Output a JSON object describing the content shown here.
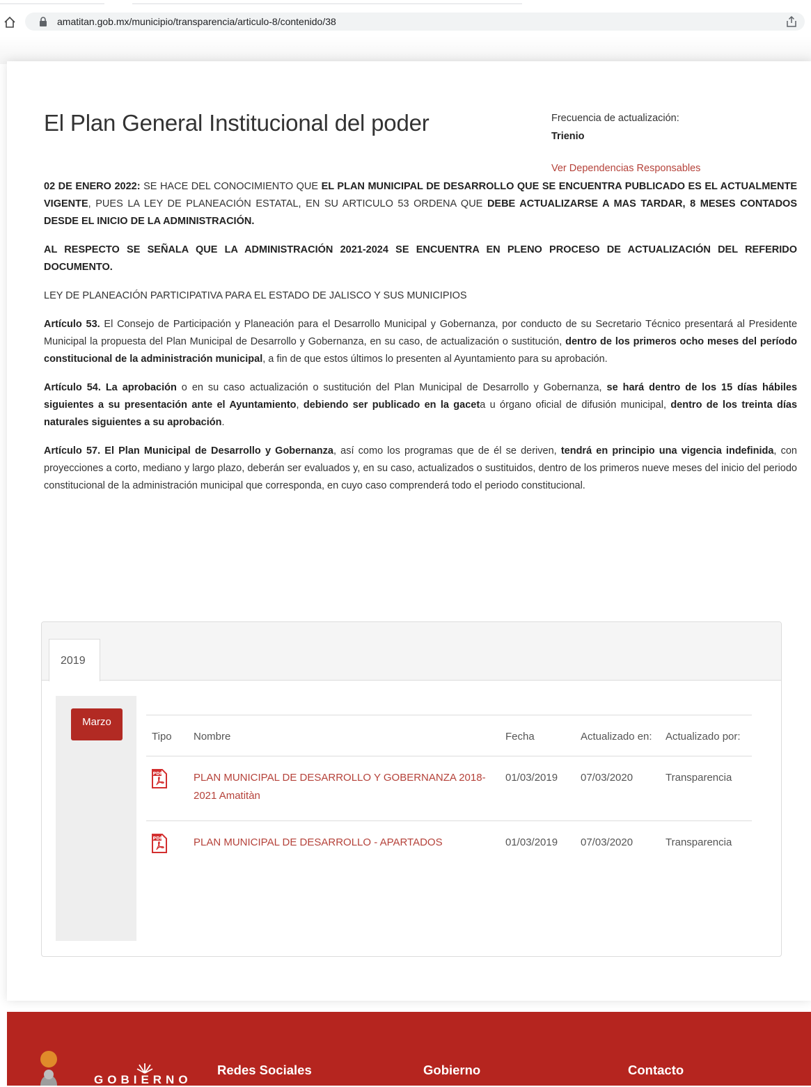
{
  "browser": {
    "url": "amatitan.gob.mx/municipio/transparencia/articulo-8/contenido/38"
  },
  "header": {
    "title": "El Plan General Institucional del poder",
    "frequency_label": "Frecuencia de actualización:",
    "frequency_value": "Trienio",
    "responsables_link": "Ver Dependencias Responsables"
  },
  "body": {
    "p1": {
      "a": "02 DE ENERO 2022:",
      "b": " SE HACE DEL CONOCIMIENTO QUE ",
      "c": "EL PLAN MUNICIPAL DE DESARROLLO QUE SE ENCUENTRA PUBLICADO ES EL ACTUALMENTE VIGENTE",
      "d": ", PUES LA LEY DE PLANEACIÓN ESTATAL, EN SU ARTICULO 53 ORDENA QUE ",
      "e": "DEBE ACTUALIZARSE A MAS TARDAR, 8 MESES CONTADOS DESDE EL INICIO DE LA ADMINISTRACIÓN."
    },
    "p2": "AL RESPECTO SE SEÑALA QUE LA ADMINISTRACIÓN 2021-2024 SE ENCUENTRA EN PLENO PROCESO DE ACTUALIZACIÓN DEL REFERIDO DOCUMENTO.",
    "p3": "LEY DE PLANEACIÓN PARTICIPATIVA PARA EL ESTADO DE JALISCO Y SUS MUNICIPIOS",
    "p4": {
      "a": "Artículo 53.",
      "b": " El Consejo de Participación y Planeación para el Desarrollo Municipal y Gobernanza, por conducto de su Secretario Técnico presentará al Presidente Municipal la propuesta del Plan Municipal de Desarrollo y Gobernanza, en su caso, de actualización o sustitución, ",
      "c": "dentro de los primeros ocho meses del período constitucional de la administración municipal",
      "d": ", a fin de que estos últimos lo presenten al Ayuntamiento para su aprobación."
    },
    "p5": {
      "a": "Artículo 54. La aprobación",
      "b": " o en su caso actualización o sustitución del Plan Municipal de Desarrollo y Gobernanza, ",
      "c": "se hará dentro de los 15 días hábiles siguientes a su presentación ante el Ayuntamiento",
      "d": ", ",
      "e": "debiendo ser publicado en la gacet",
      "f": "a u órgano oficial de difusión municipal, ",
      "g": "dentro de los treinta días naturales siguientes a su aprobación",
      "h": "."
    },
    "p6": {
      "a": "Artículo 57. El Plan Municipal de Desarrollo y Gobernanza",
      "b": ", así como los programas que de él se deriven, ",
      "c": "tendrá en principio una vigencia indefinida",
      "d": ", con proyecciones a corto, mediano y largo plazo, deberán ser evaluados y, en su caso, actualizados o sustituidos, dentro de los primeros nueve meses del inicio del periodo constitucional de la administración municipal que corresponda, en cuyo caso comprenderá todo el periodo constitucional."
    }
  },
  "documents": {
    "year_tab": "2019",
    "month": "Marzo",
    "columns": {
      "tipo": "Tipo",
      "nombre": "Nombre",
      "fecha": "Fecha",
      "actualizado_en": "Actualizado en:",
      "actualizado_por": "Actualizado por:"
    },
    "rows": [
      {
        "icon": "pdf-icon",
        "nombre": "PLAN MUNICIPAL DE DESARROLLO Y GOBERNANZA 2018-2021 Amatitàn",
        "fecha": "01/03/2019",
        "actualizado_en": "07/03/2020",
        "actualizado_por": "Transparencia"
      },
      {
        "icon": "pdf-icon",
        "nombre": "PLAN MUNICIPAL DE DESARROLLO - APARTADOS",
        "fecha": "01/03/2019",
        "actualizado_en": "07/03/2020",
        "actualizado_por": "Transparencia"
      }
    ]
  },
  "footer": {
    "logo_text": "GOBIERNO",
    "col1": "Redes Sociales",
    "col2": "Gobierno",
    "col3": "Contacto"
  },
  "colors": {
    "brand_red": "#b5251f",
    "link_red": "#b5423a",
    "button_red": "#b22a23"
  }
}
